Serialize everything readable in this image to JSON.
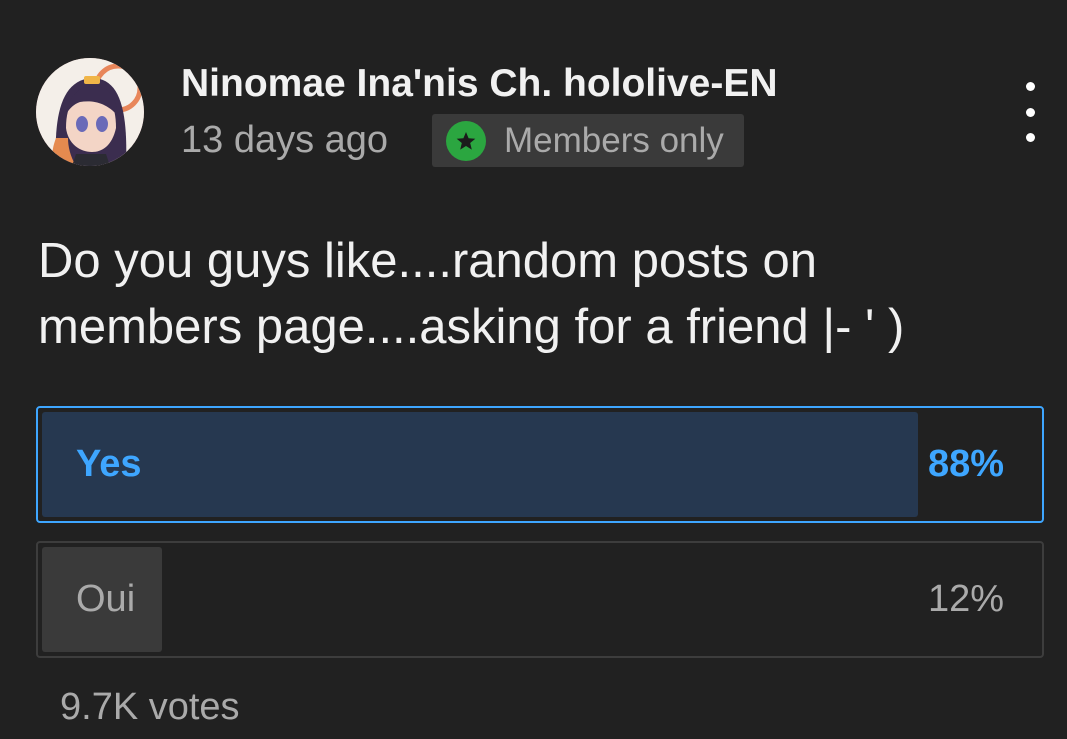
{
  "post": {
    "channel_name": "Ninomae Ina'nis Ch. hololive-EN",
    "time": "13 days ago",
    "badge_label": "Members only",
    "badge_icon": "star-icon",
    "menu_icon": "more-vert-icon",
    "text": "Do you guys like....random posts on members page....asking for a friend |- ' )"
  },
  "poll": {
    "options": [
      {
        "label": "Yes",
        "percent_text": "88%",
        "share": 0.88,
        "selected": true
      },
      {
        "label": "Oui",
        "percent_text": "12%",
        "share": 0.12,
        "selected": false
      }
    ],
    "votes": "9.7K votes"
  },
  "colors": {
    "background": "#212121",
    "accent": "#3ea6ff",
    "selected_fill": "#263850",
    "badge_green": "#2ba640"
  }
}
